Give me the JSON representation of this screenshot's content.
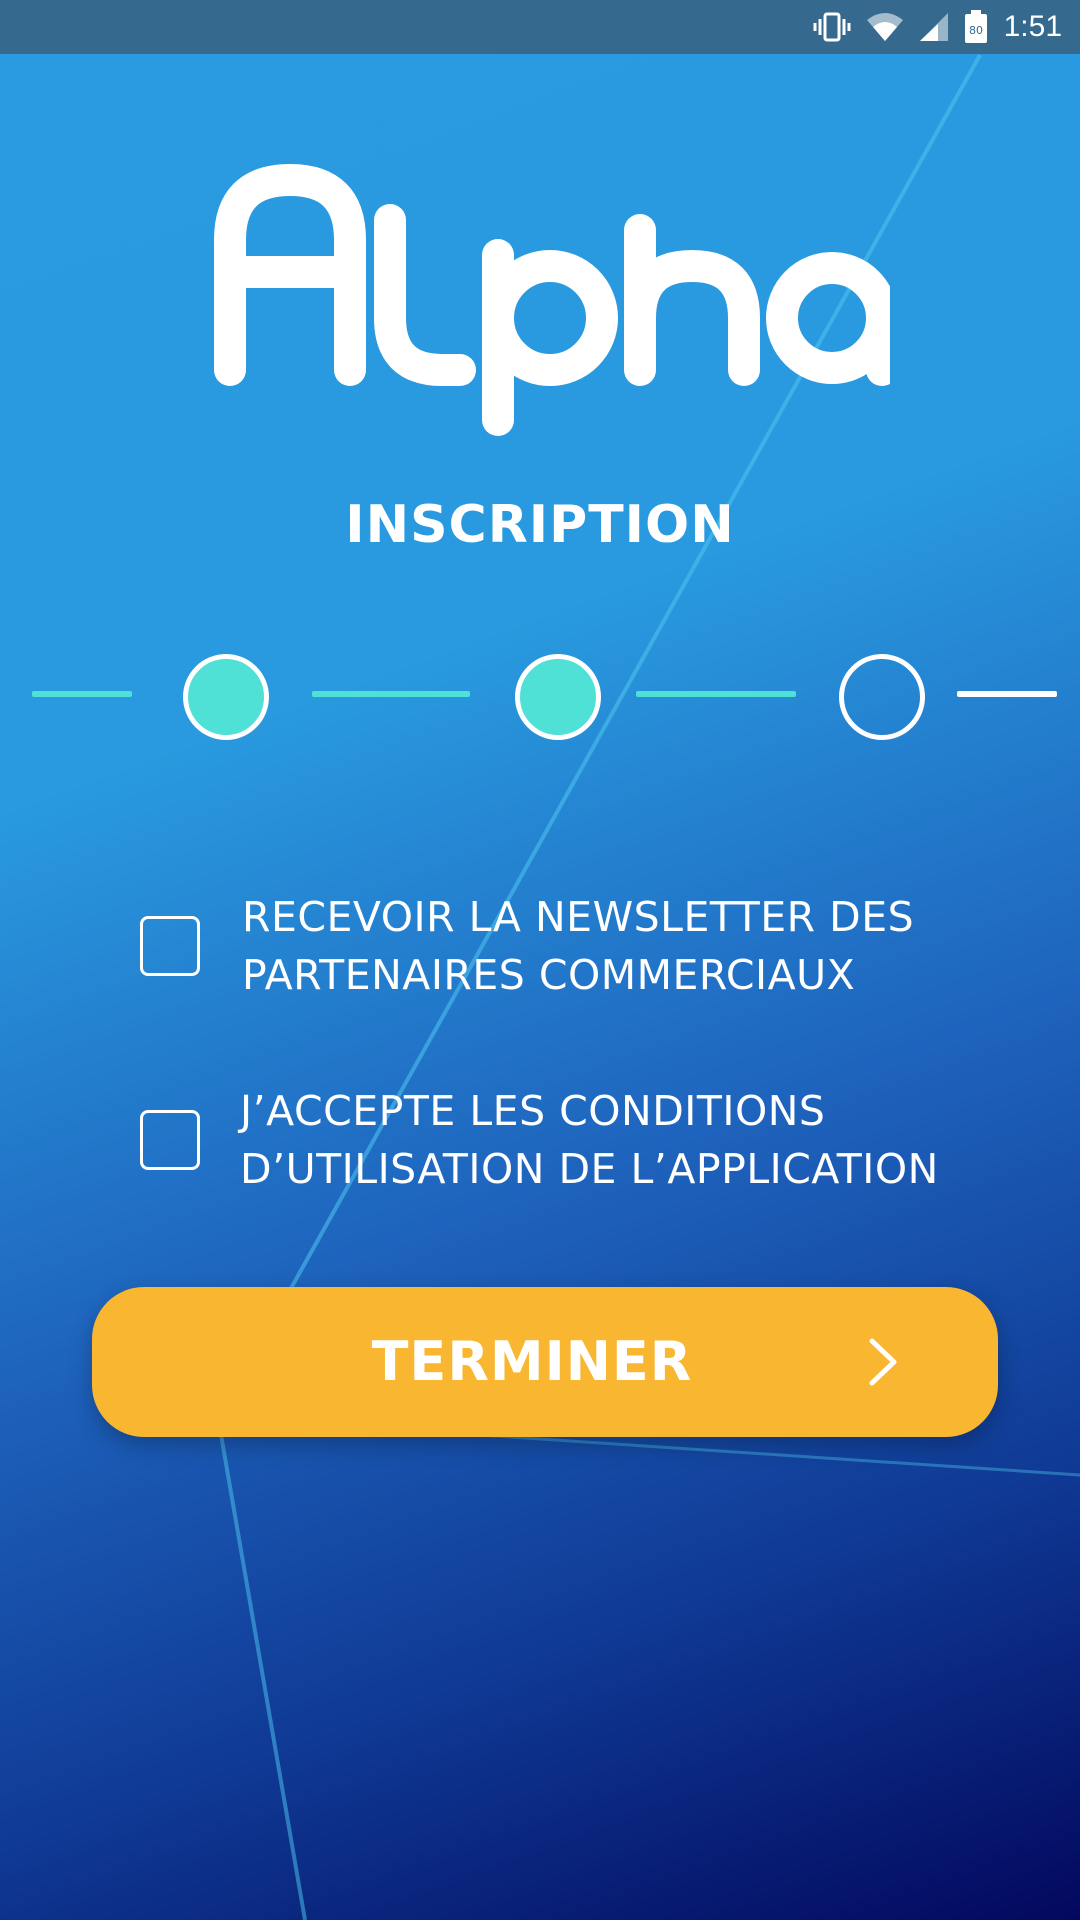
{
  "status_bar": {
    "time": "1:51",
    "battery_level": "80",
    "icons": [
      "vibrate-icon",
      "wifi-icon",
      "signal-icon",
      "battery-icon"
    ]
  },
  "logo": {
    "text": "Alpha"
  },
  "title": "INSCRIPTION",
  "stepper": {
    "total_steps": 3,
    "completed_steps": 2,
    "colors": {
      "done": "#4fe0d6",
      "pending_outline": "#ffffff"
    }
  },
  "options": [
    {
      "label": "RECEVOIR LA NEWSLETTER DES\nPARTENAIRES COMMERCIAUX",
      "checked": false
    },
    {
      "label": "J’ACCEPTE LES CONDITIONS\nD’UTILISATION DE L’APPLICATION",
      "checked": false
    }
  ],
  "submit_button": {
    "label": "TERMINER",
    "icon": "chevron-right-icon"
  },
  "colors": {
    "accent": "#f8b631",
    "status_bar": "#356a8e",
    "gradient_start": "#2a9be0",
    "gradient_end": "#03085e",
    "step_done": "#4fe0d6"
  }
}
